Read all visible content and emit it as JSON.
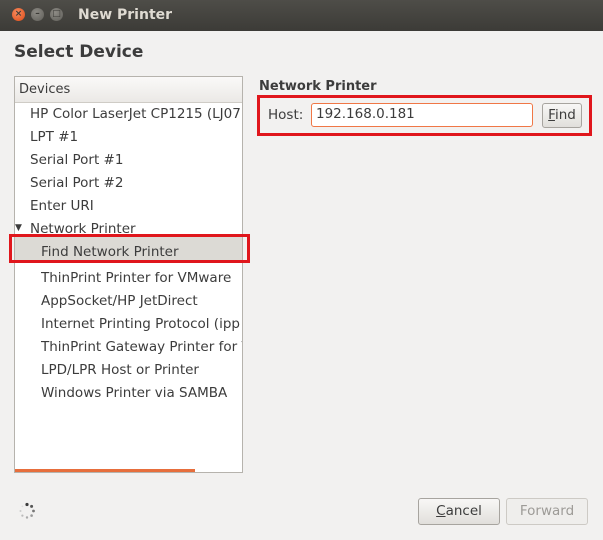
{
  "window": {
    "title": "New Printer",
    "close_glyph": "×",
    "min_glyph": "–",
    "max_glyph": "□"
  },
  "heading": "Select Device",
  "devices": {
    "column_header": "Devices",
    "items": [
      "HP Color LaserJet CP1215 (LJ07",
      "LPT #1",
      "Serial Port #1",
      "Serial Port #2",
      "Enter URI",
      "Network Printer",
      "Find Network Printer",
      "ThinPrint Printer for VMware",
      "AppSocket/HP JetDirect",
      "Internet Printing Protocol (ipp",
      "ThinPrint Gateway Printer for V",
      "LPD/LPR Host or Printer",
      "Windows Printer via SAMBA"
    ],
    "selected_index": 6,
    "expander_glyph": "▼"
  },
  "network_printer": {
    "heading": "Network Printer",
    "host_label": "Host:",
    "host_value": "192.168.0.181",
    "find_mnemonic": "F",
    "find_rest": "ind"
  },
  "footer": {
    "cancel_mnemonic": "C",
    "cancel_rest": "ancel",
    "forward_label": "Forward"
  },
  "colors": {
    "accent": "#f07746",
    "highlight_box": "#e0161c",
    "titlebar": "#3c3b37"
  }
}
